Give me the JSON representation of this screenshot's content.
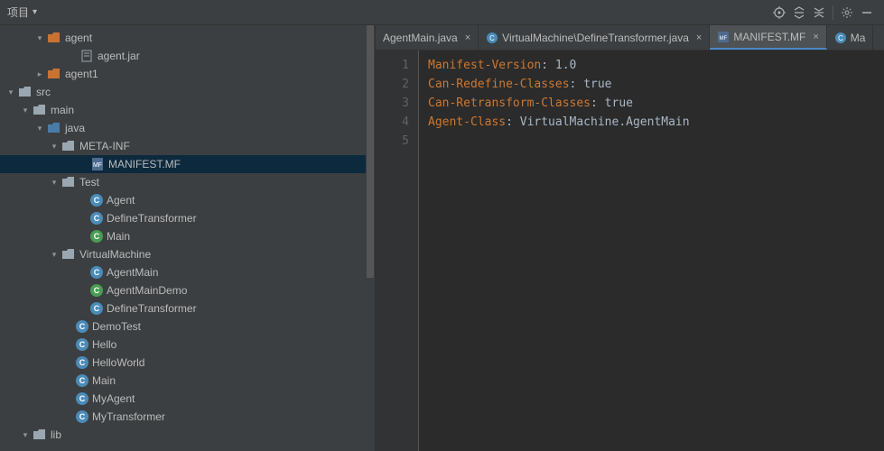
{
  "toolbar": {
    "title": "项目"
  },
  "tree": {
    "agent": {
      "label": "agent"
    },
    "agent_jar": {
      "label": "agent.jar"
    },
    "agent1": {
      "label": "agent1"
    },
    "src": {
      "label": "src"
    },
    "main": {
      "label": "main"
    },
    "java": {
      "label": "java"
    },
    "metainf": {
      "label": "META-INF"
    },
    "manifest": {
      "label": "MANIFEST.MF"
    },
    "test_pkg": {
      "label": "Test"
    },
    "agent_cls": {
      "label": "Agent"
    },
    "definetrans_cls": {
      "label": "DefineTransformer"
    },
    "main_cls": {
      "label": "Main"
    },
    "vm_pkg": {
      "label": "VirtualMachine"
    },
    "agentmain_cls": {
      "label": "AgentMain"
    },
    "agentmaindemo_cls": {
      "label": "AgentMainDemo"
    },
    "definetrans2_cls": {
      "label": "DefineTransformer"
    },
    "demotest_cls": {
      "label": "DemoTest"
    },
    "hello_cls": {
      "label": "Hello"
    },
    "helloworld_cls": {
      "label": "HelloWorld"
    },
    "main2_cls": {
      "label": "Main"
    },
    "myagent_cls": {
      "label": "MyAgent"
    },
    "mytrans_cls": {
      "label": "MyTransformer"
    },
    "lib": {
      "label": "lib"
    }
  },
  "tabs": {
    "t1": {
      "label": "AgentMain.java"
    },
    "t2": {
      "label": "VirtualMachine\\DefineTransformer.java"
    },
    "t3": {
      "label": "MANIFEST.MF"
    },
    "t4": {
      "label": "Ma"
    }
  },
  "code": {
    "l1k": "Manifest-Version",
    "l1v": ": 1.0",
    "l2k": "Can-Redefine-Classes",
    "l2v": ": true",
    "l3k": "Can-Retransform-Classes",
    "l3v": ": true",
    "l4k": "Agent-Class",
    "l4v": ": VirtualMachine.AgentMain"
  },
  "gutter": {
    "l1": "1",
    "l2": "2",
    "l3": "3",
    "l4": "4",
    "l5": "5"
  }
}
